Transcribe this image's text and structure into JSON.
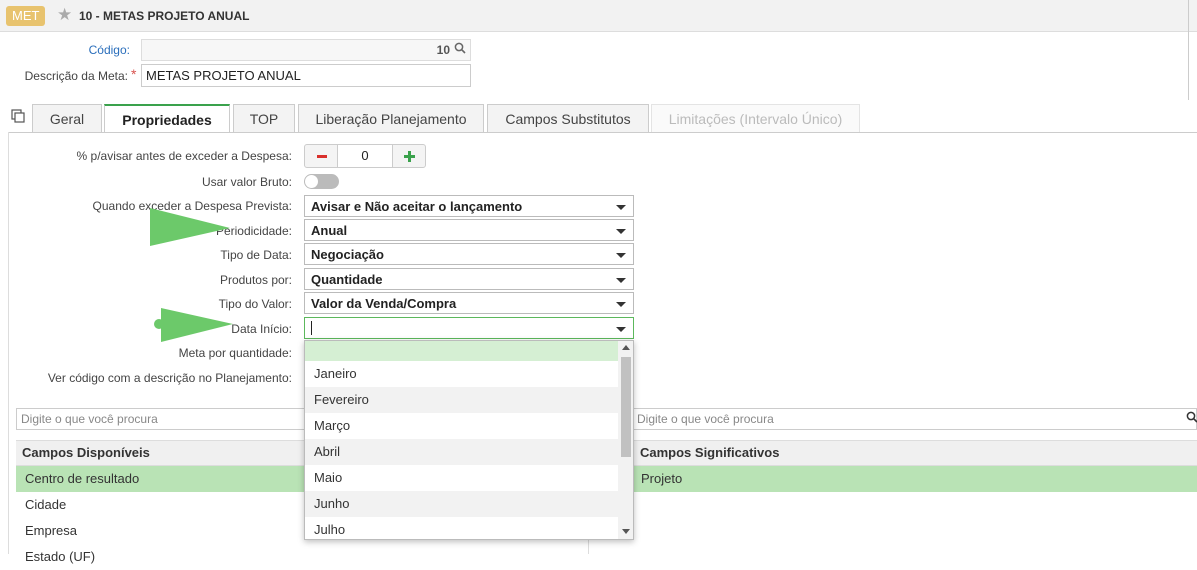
{
  "header": {
    "badge": "MET",
    "title": "10 - METAS PROJETO ANUAL"
  },
  "form_top": {
    "codigo_label": "Código:",
    "codigo_value": "10",
    "descricao_label": "Descrição da Meta:",
    "required_mark": "*",
    "descricao_value": "METAS PROJETO ANUAL"
  },
  "tabs": [
    {
      "label": "Geral"
    },
    {
      "label": "Propriedades"
    },
    {
      "label": "TOP"
    },
    {
      "label": "Liberação Planejamento"
    },
    {
      "label": "Campos Substitutos"
    },
    {
      "label": "Limitações (Intervalo Único)"
    }
  ],
  "props": {
    "avisar_label": "% p/avisar antes de exceder a Despesa:",
    "avisar_value": "0",
    "bruto_label": "Usar valor Bruto:",
    "exceder_label": "Quando exceder a Despesa Prevista:",
    "exceder_value": "Avisar e Não aceitar o lançamento",
    "periodicidade_label": "Periodicidade:",
    "periodicidade_value": "Anual",
    "tipo_data_label": "Tipo de Data:",
    "tipo_data_value": "Negociação",
    "produtos_label": "Produtos por:",
    "produtos_value": "Quantidade",
    "tipo_valor_label": "Tipo do Valor:",
    "tipo_valor_value": "Valor da Venda/Compra",
    "data_inicio_label": "Data Início:",
    "meta_qtd_label": "Meta por quantidade:",
    "ver_codigo_label": "Ver código com a descrição no Planejamento:"
  },
  "dropdown_options": [
    "",
    "Janeiro",
    "Fevereiro",
    "Março",
    "Abril",
    "Maio",
    "Junho",
    "Julho"
  ],
  "left_panel": {
    "search_placeholder": "Digite o que você procura",
    "header": "Campos Disponíveis",
    "rows": [
      "Centro de resultado",
      "Cidade",
      "Empresa",
      "Estado (UF)"
    ]
  },
  "right_panel": {
    "search_placeholder": "Digite o que você procura",
    "header": "Campos Significativos",
    "rows": [
      "Projeto"
    ]
  },
  "colors": {
    "accent_green": "#3aa24c",
    "badge": "#e8c36e",
    "selected_row": "#b9e3b5",
    "annotation_arrow": "#6cc96a"
  }
}
